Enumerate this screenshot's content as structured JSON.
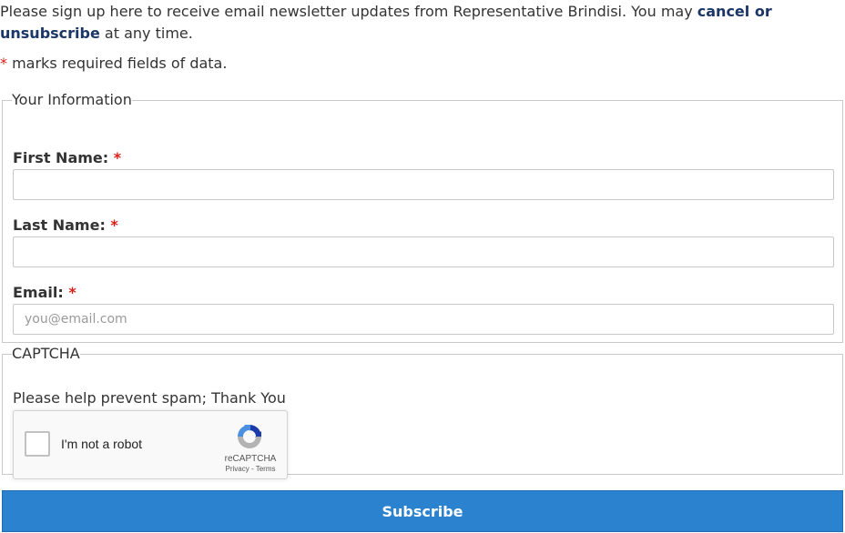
{
  "intro": {
    "text_before": "Please sign up here to receive email newsletter updates from Representative Brindisi. You may ",
    "link_text": "cancel or unsubscribe",
    "text_after": " at any time."
  },
  "required_note": {
    "star": "*",
    "text": " marks required fields of data."
  },
  "your_information": {
    "legend": "Your Information",
    "first_name": {
      "label": "First Name:",
      "star": "*",
      "value": "",
      "placeholder": ""
    },
    "last_name": {
      "label": "Last Name:",
      "star": "*",
      "value": "",
      "placeholder": ""
    },
    "email": {
      "label": "Email:",
      "star": "*",
      "value": "",
      "placeholder": "you@email.com"
    }
  },
  "captcha": {
    "legend": "CAPTCHA",
    "prompt": "Please help prevent spam; Thank You",
    "widget": {
      "checkbox_label": "I'm not a robot",
      "brand": "reCAPTCHA",
      "privacy": "Privacy",
      "separator": " - ",
      "terms": "Terms",
      "icon": "recaptcha-logo-icon",
      "checked": false
    }
  },
  "subscribe_label": "Subscribe",
  "colors": {
    "link": "#1b3667",
    "required_star": "#d91e18",
    "button_bg": "#2b83cf",
    "button_text": "#ffffff",
    "border": "#c8c8c8"
  }
}
